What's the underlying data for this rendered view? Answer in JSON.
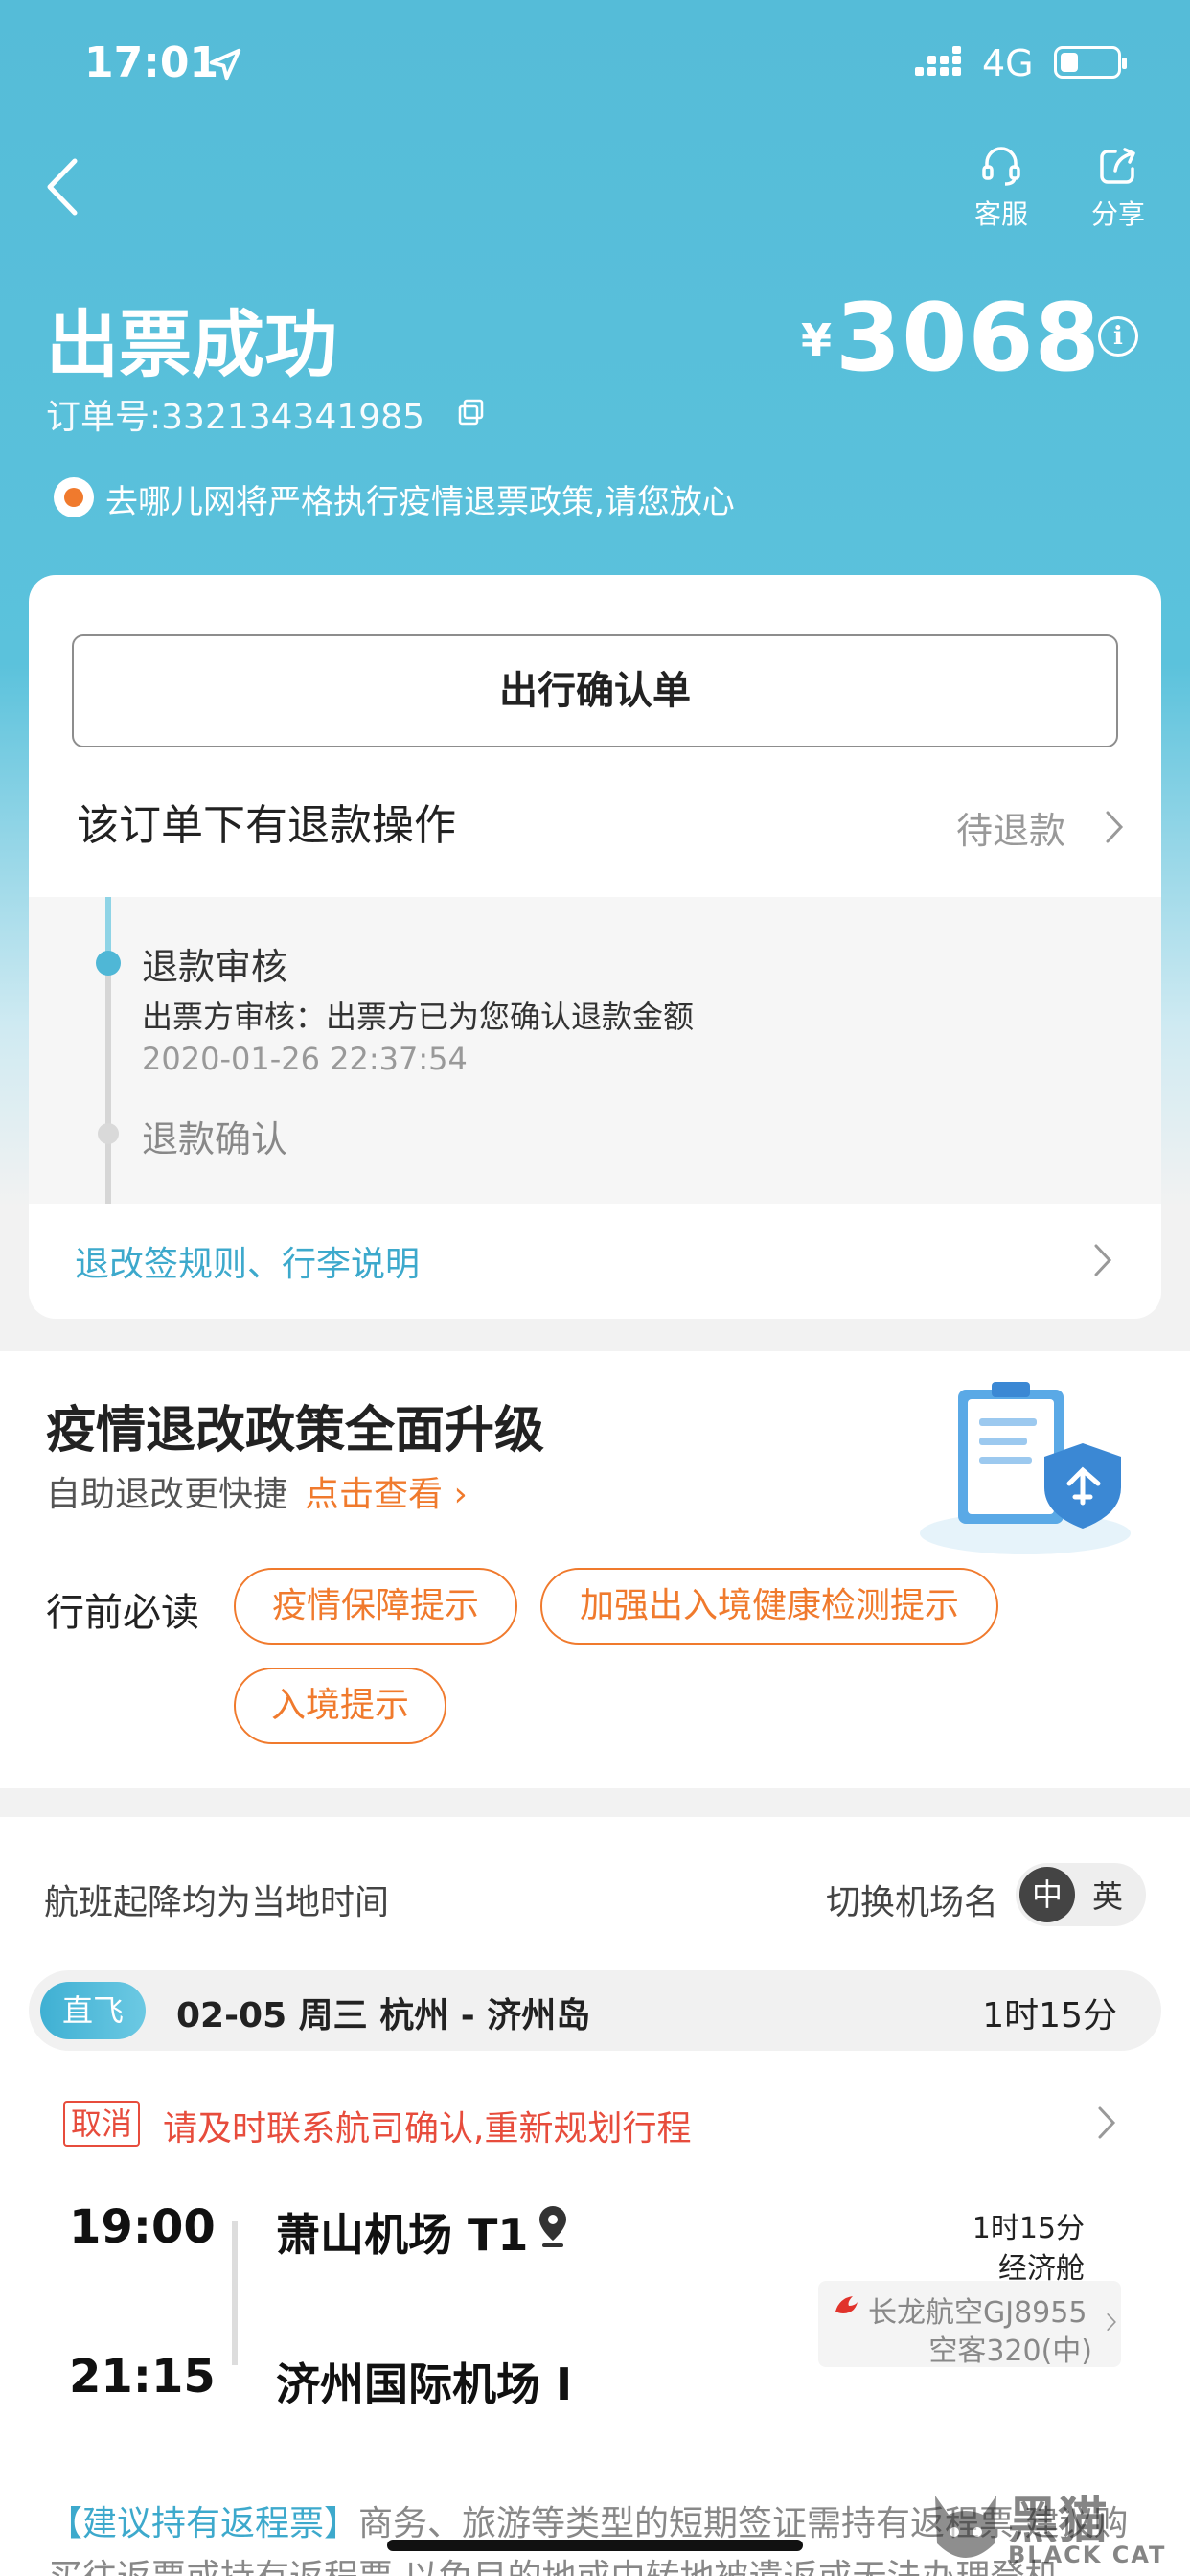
{
  "status_bar": {
    "time": "17:01",
    "network": "4G"
  },
  "nav": {
    "service_label": "客服",
    "share_label": "分享"
  },
  "header": {
    "title": "出票成功",
    "order_number": "订单号:332134341985",
    "price_symbol": "¥",
    "price": "3068",
    "info_glyph": "i",
    "notice": "去哪儿网将严格执行疫情退票政策,请您放心"
  },
  "card": {
    "confirm_button": "出行确认单",
    "refund_title": "该订单下有退款操作",
    "refund_status": "待退款",
    "timeline": {
      "step1_title": "退款审核",
      "step1_desc": "出票方审核：出票方已为您确认退款金额",
      "step1_time": "2020-01-26 22:37:54",
      "step2_title": "退款确认"
    },
    "rules_link": "退改签规则、行李说明"
  },
  "policy": {
    "title": "疫情退改政策全面升级",
    "subtitle": "自助退改更快捷",
    "link": "点击查看 ›",
    "must_read_label": "行前必读",
    "pills": [
      "疫情保障提示",
      "加强出入境健康检测提示",
      "入境提示"
    ]
  },
  "flight": {
    "local_time_note": "航班起降均为当地时间",
    "switch_label": "切换机场名",
    "switch_cn": "中",
    "switch_en": "英",
    "direct_tag": "直飞",
    "route": "02-05  周三  杭州 - 济州岛",
    "route_duration": "1时15分",
    "cancel_tag": "取消",
    "cancel_text": "请及时联系航司确认,重新规划行程",
    "dep_time": "19:00",
    "dep_airport": "萧山机场 T1",
    "arr_time": "21:15",
    "arr_airport": "济州国际机场 I",
    "seg_duration": "1时15分",
    "cabin": "经济舱",
    "airline": "长龙航空GJ8955",
    "aircraft": "空客320(中)",
    "note_highlight": "【建议持有返程票】",
    "note_text": "商务、旅游等类型的短期签证需持有返程票,建议购买往返票或持有返程票,以免目的地或中转地被遣返或无法办理登机"
  },
  "watermark": {
    "text": "黑猫",
    "sub": "BLACK CAT"
  },
  "colors": {
    "accent": "#55bcd8",
    "orange": "#f07a2d",
    "cancel_red": "#e74c3c",
    "link_blue": "#3da9cc"
  }
}
